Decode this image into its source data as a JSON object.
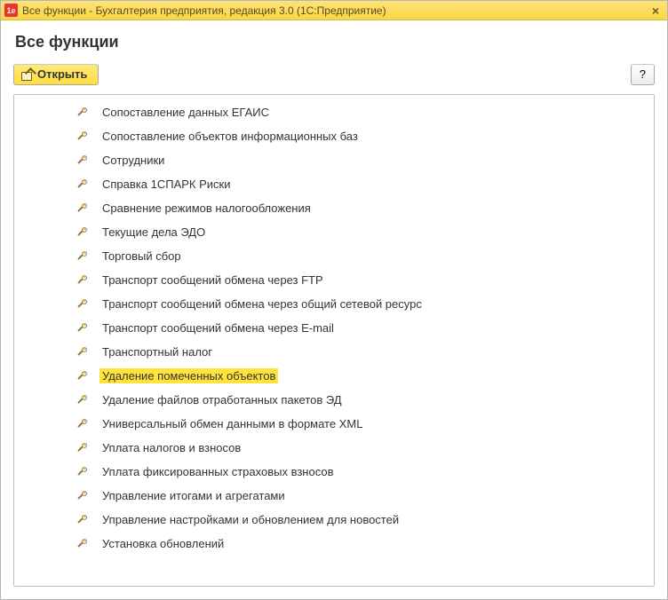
{
  "window": {
    "title": "Все функции - Бухгалтерия предприятия, редакция 3.0  (1С:Предприятие)",
    "app_icon": "1c-icon"
  },
  "page": {
    "title": "Все функции"
  },
  "toolbar": {
    "open_label": "Открыть",
    "help_label": "?"
  },
  "tree": {
    "items": [
      {
        "label": "Сопоставление данных ЕГАИС",
        "highlighted": false
      },
      {
        "label": "Сопоставление объектов информационных баз",
        "highlighted": false
      },
      {
        "label": "Сотрудники",
        "highlighted": false
      },
      {
        "label": "Справка 1СПАРК Риски",
        "highlighted": false
      },
      {
        "label": "Сравнение режимов налогообложения",
        "highlighted": false
      },
      {
        "label": "Текущие дела ЭДО",
        "highlighted": false
      },
      {
        "label": "Торговый сбор",
        "highlighted": false
      },
      {
        "label": "Транспорт сообщений обмена через FTP",
        "highlighted": false
      },
      {
        "label": "Транспорт сообщений обмена через общий сетевой ресурс",
        "highlighted": false
      },
      {
        "label": "Транспорт сообщений обмена через E-mail",
        "highlighted": false
      },
      {
        "label": "Транспортный налог",
        "highlighted": false
      },
      {
        "label": "Удаление помеченных объектов",
        "highlighted": true
      },
      {
        "label": "Удаление файлов отработанных пакетов ЭД",
        "highlighted": false
      },
      {
        "label": "Универсальный обмен данными в формате XML",
        "highlighted": false
      },
      {
        "label": "Уплата налогов и взносов",
        "highlighted": false
      },
      {
        "label": "Уплата фиксированных страховых взносов",
        "highlighted": false
      },
      {
        "label": "Управление итогами и агрегатами",
        "highlighted": false
      },
      {
        "label": "Управление настройками и обновлением для новостей",
        "highlighted": false
      },
      {
        "label": "Установка обновлений",
        "highlighted": false
      }
    ]
  }
}
